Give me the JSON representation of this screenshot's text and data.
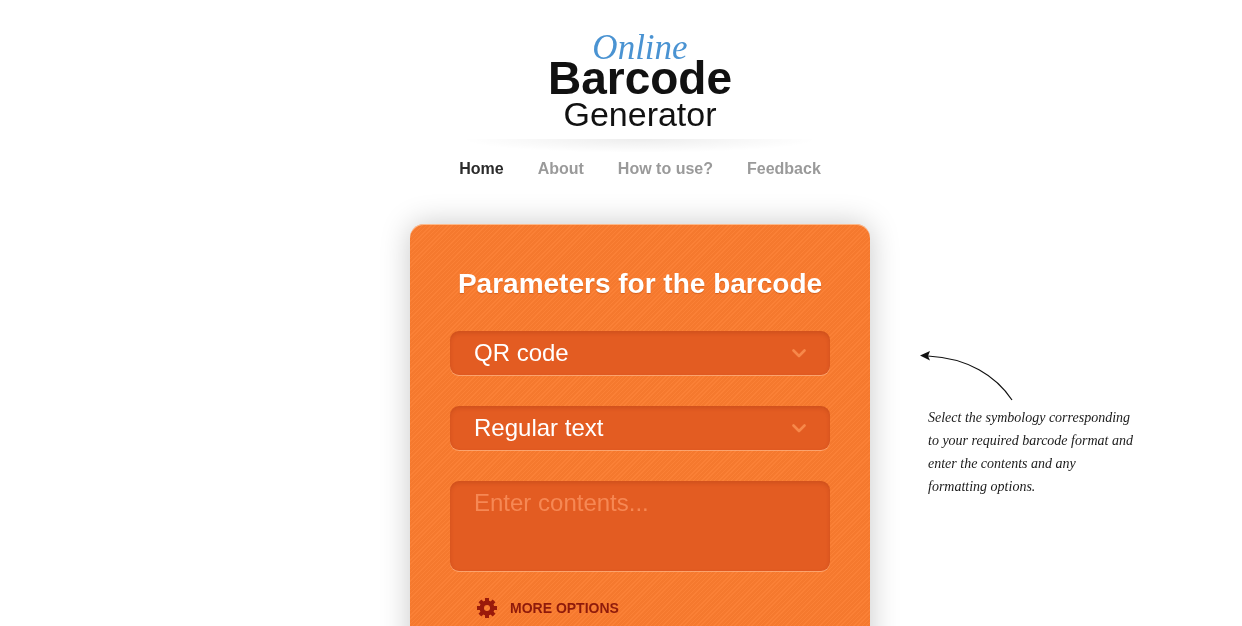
{
  "logo": {
    "tagline": "Online",
    "title": "Barcode",
    "subtitle": "Generator"
  },
  "nav": [
    {
      "label": "Home",
      "selected": true
    },
    {
      "label": "About",
      "selected": false
    },
    {
      "label": "How to use?",
      "selected": false
    },
    {
      "label": "Feedback",
      "selected": false
    }
  ],
  "panel": {
    "title": "Parameters for the barcode",
    "dropdowns": [
      {
        "value": "QR code"
      },
      {
        "value": "Regular text"
      }
    ],
    "contents_field": {
      "placeholder": "Enter contents..."
    },
    "more_options": {
      "label": "MORE OPTIONS"
    }
  },
  "annotation": {
    "text": "Select the symbology corresponding to your required barcode format and enter the contents and any formatting options."
  }
}
